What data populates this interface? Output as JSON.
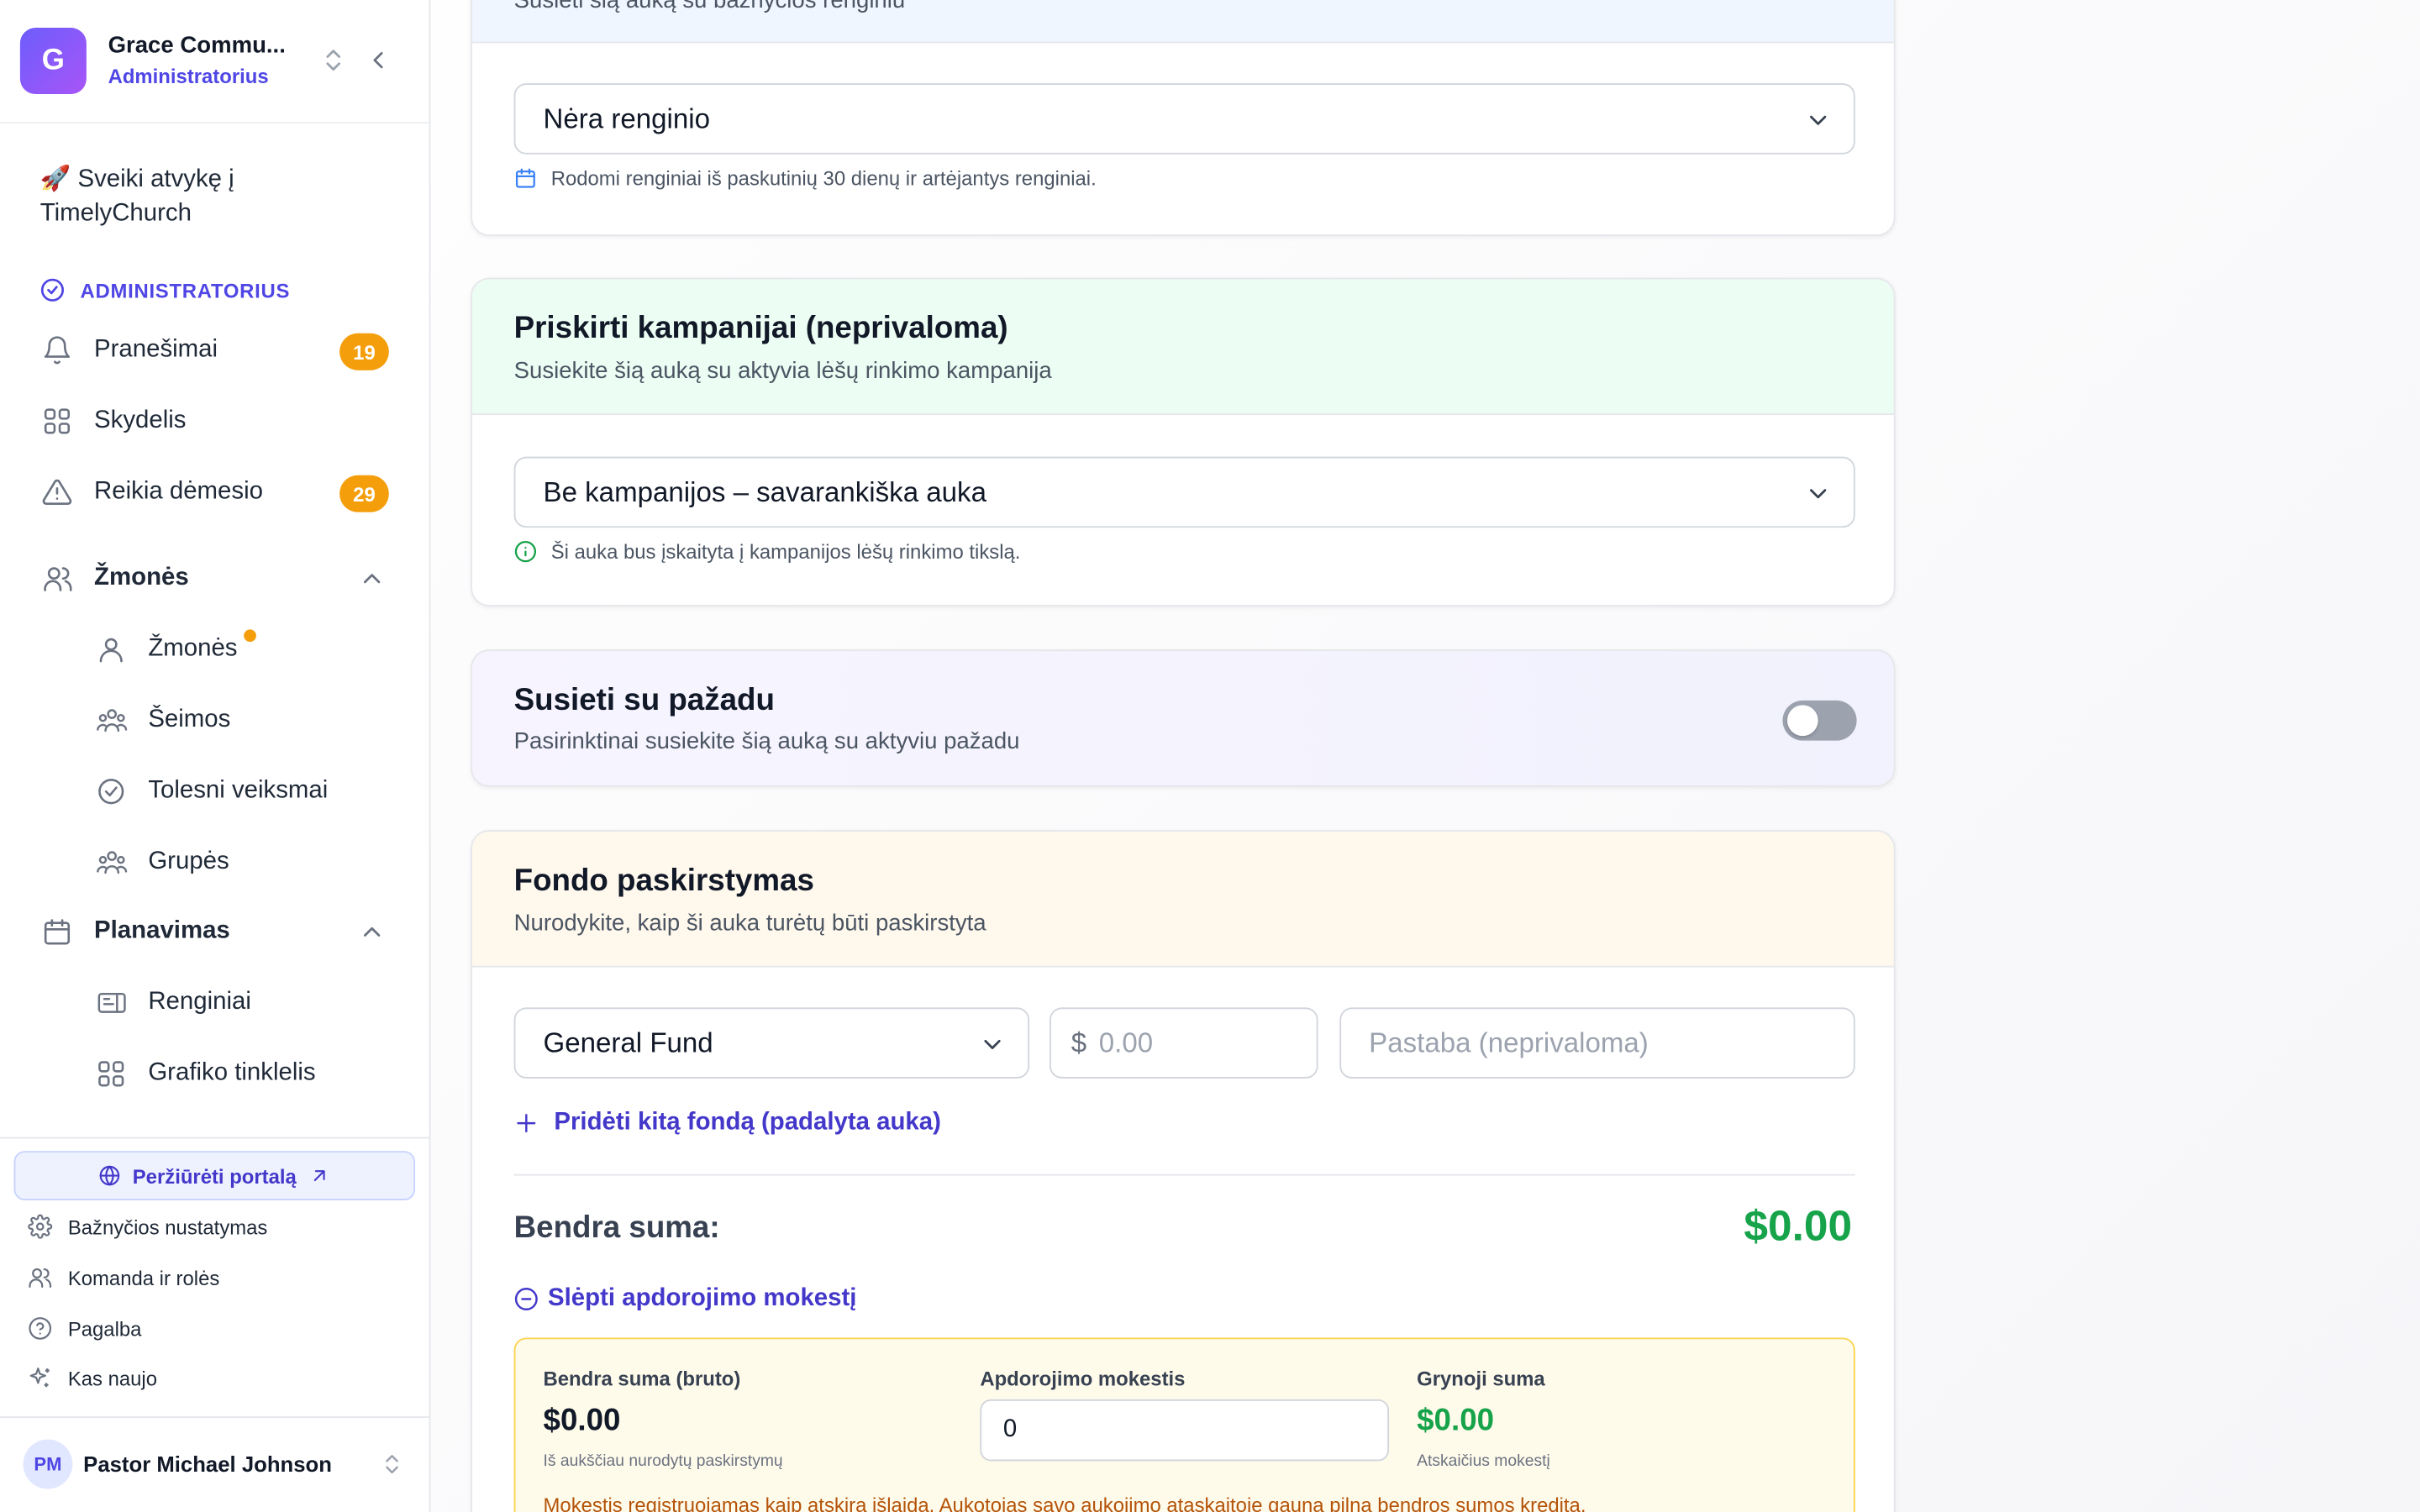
{
  "org": {
    "initial": "G",
    "name": "Grace Commu...",
    "role": "Administratorius"
  },
  "welcome": "🚀 Sveiki atvykę į TimelyChurch",
  "section": {
    "label": "ADMINISTRATORIUS"
  },
  "nav": {
    "notifications": {
      "label": "Pranešimai",
      "badge": "19",
      "icon": "bell-icon"
    },
    "dashboard": {
      "label": "Skydelis",
      "icon": "grid-icon"
    },
    "attention": {
      "label": "Reikia dėmesio",
      "badge": "29",
      "icon": "alert-triangle-icon"
    },
    "people_group": {
      "label": "Žmonės",
      "icon": "users-icon"
    },
    "people": {
      "label": "Žmonės",
      "icon": "user-icon"
    },
    "families": {
      "label": "Šeimos",
      "icon": "family-icon"
    },
    "followups": {
      "label": "Tolesni veiksmai",
      "icon": "check-circle-icon"
    },
    "groups": {
      "label": "Grupės",
      "icon": "groups-icon"
    },
    "planning_group": {
      "label": "Planavimas",
      "icon": "calendar-icon"
    },
    "events": {
      "label": "Renginiai",
      "icon": "ticket-icon"
    },
    "schedule_grid": {
      "label": "Grafiko tinklelis",
      "icon": "grid-icon"
    }
  },
  "footer": {
    "portal_button": "Peržiūrėti portalą",
    "church_settings": "Bažnyčios nustatymas",
    "team_roles": "Komanda ir rolės",
    "help": "Pagalba",
    "whats_new": "Kas naujo"
  },
  "user": {
    "initials": "PM",
    "name": "Pastor Michael Johnson"
  },
  "event_card": {
    "subtitle_partial": "Susieti šią auką su bažnyčios renginiu",
    "select_value": "Nėra renginio",
    "hint": "Rodomi renginiai iš paskutinių 30 dienų ir artėjantys renginiai."
  },
  "campaign_card": {
    "title": "Priskirti kampanijai (neprivaloma)",
    "subtitle": "Susiekite šią auką su aktyvia lėšų rinkimo kampanija",
    "select_value": "Be kampanijos – savarankiška auka",
    "hint": "Ši auka bus įskaityta į kampanijos lėšų rinkimo tikslą."
  },
  "pledge_card": {
    "title": "Susieti su pažadu",
    "subtitle": "Pasirinktinai susiekite šią auką su aktyviu pažadu",
    "toggle_on": false
  },
  "fund_card": {
    "title": "Fondo paskirstymas",
    "subtitle": "Nurodykite, kaip ši auka turėtų būti paskirstyta",
    "fund_select": "General Fund",
    "amount_prefix": "$",
    "amount_placeholder": "0.00",
    "note_placeholder": "Pastaba (neprivaloma)",
    "add_fund": "Pridėti kitą fondą (padalyta auka)",
    "total_label": "Bendra suma:",
    "total_value": "$0.00",
    "fee_toggle": "Slėpti apdorojimo mokestį",
    "gross_label": "Bendra suma (bruto)",
    "gross_value": "$0.00",
    "gross_note": "Iš aukščiau nurodytų paskirstymų",
    "fee_label": "Apdorojimo mokestis",
    "fee_value": "0",
    "net_label": "Grynoji suma",
    "net_value": "$0.00",
    "net_note": "Atskaičius mokestį",
    "fee_warning": "Mokestis registruojamas kaip atskira išlaida. Aukotojas savo aukojimo ataskaitoje gauna pilną bendros sumos kreditą."
  },
  "colors": {
    "accent": "#4f46e5",
    "success": "#16a34a",
    "warning": "#f59e0b"
  }
}
